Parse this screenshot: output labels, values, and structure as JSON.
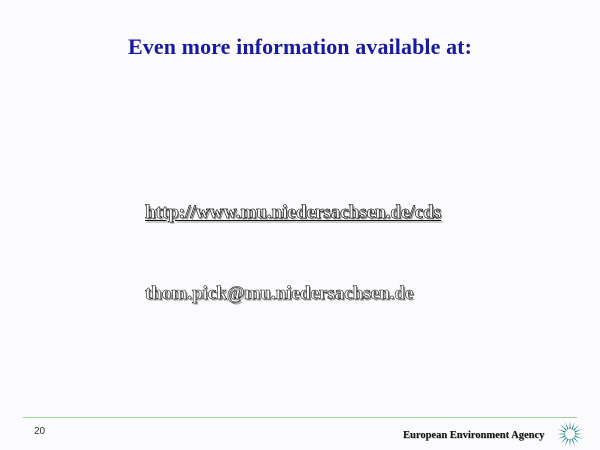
{
  "slide": {
    "title": "Even more information available at:",
    "url": "http://www.mu.niedersachsen.de/cds",
    "email": "thom.pick@mu.niedersachsen.de",
    "page_number": "20",
    "footer_org": "European Environment Agency"
  },
  "colors": {
    "title": "#1a1aa0",
    "divider": "#9fd49f",
    "logo_green": "#1e9a3c",
    "logo_blue": "#1c6fc4"
  },
  "icons": {
    "logo": "eea-sunburst-logo"
  }
}
